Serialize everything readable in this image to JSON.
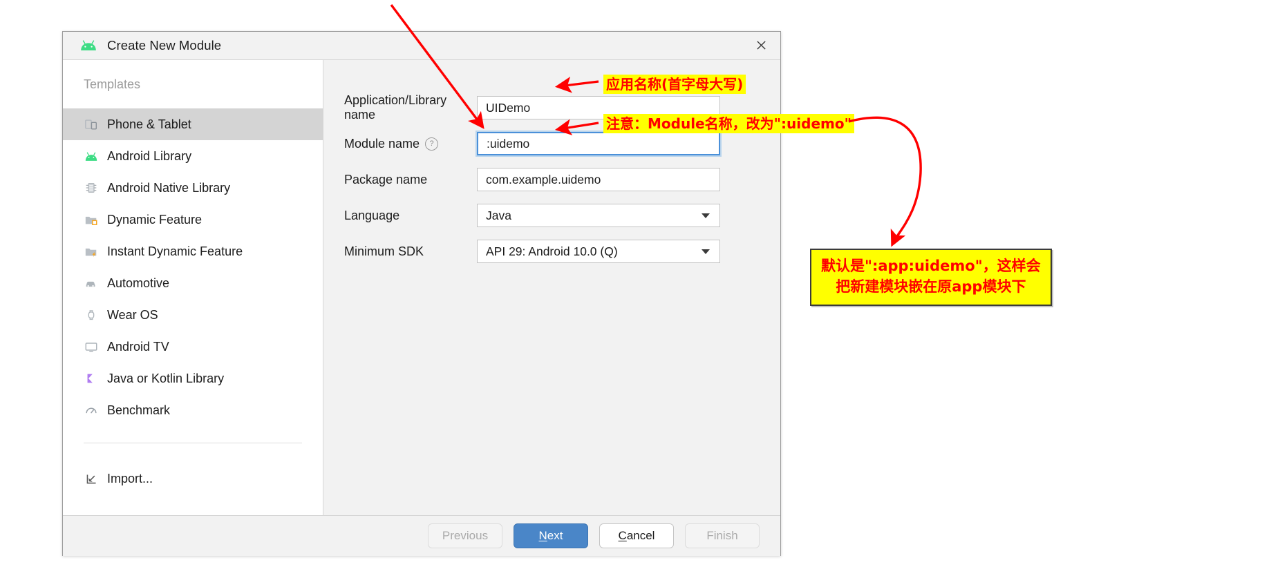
{
  "dialog": {
    "title": "Create New Module",
    "logo_icon": "android-logo-icon",
    "close_icon": "close-icon"
  },
  "sidebar": {
    "header": "Templates",
    "items": [
      {
        "label": "Phone & Tablet",
        "icon": "phone-tablet-icon",
        "selected": true
      },
      {
        "label": "Android Library",
        "icon": "android-library-icon",
        "selected": false
      },
      {
        "label": "Android Native Library",
        "icon": "android-native-library-icon",
        "selected": false
      },
      {
        "label": "Dynamic Feature",
        "icon": "dynamic-feature-icon",
        "selected": false
      },
      {
        "label": "Instant Dynamic Feature",
        "icon": "instant-dynamic-feature-icon",
        "selected": false
      },
      {
        "label": "Automotive",
        "icon": "automotive-icon",
        "selected": false
      },
      {
        "label": "Wear OS",
        "icon": "wear-os-icon",
        "selected": false
      },
      {
        "label": "Android TV",
        "icon": "android-tv-icon",
        "selected": false
      },
      {
        "label": "Java or Kotlin Library",
        "icon": "java-kotlin-library-icon",
        "selected": false
      },
      {
        "label": "Benchmark",
        "icon": "benchmark-icon",
        "selected": false
      }
    ],
    "import_label": "Import...",
    "import_icon": "import-icon"
  },
  "form": {
    "app_name": {
      "label": "Application/Library name",
      "value": "UIDemo"
    },
    "module_name": {
      "label": "Module name",
      "help_icon": "help-icon",
      "value": ":uidemo",
      "focused": true
    },
    "package_name": {
      "label": "Package name",
      "value": "com.example.uidemo"
    },
    "language": {
      "label": "Language",
      "value": "Java",
      "dropdown_icon": "chevron-down-icon"
    },
    "min_sdk": {
      "label": "Minimum SDK",
      "value": "API 29: Android 10.0 (Q)",
      "dropdown_icon": "chevron-down-icon"
    }
  },
  "footer": {
    "previous": "Previous",
    "next": "Next",
    "next_mnemonic": "N",
    "cancel": "Cancel",
    "cancel_mnemonic": "C",
    "finish": "Finish"
  },
  "annotations": {
    "app_name_note": "应用名称(首字母大写)",
    "module_name_note": "注意：Module名称，改为\":uidemo\"",
    "warning_line1": "默认是\":app:uidemo\"，这样会",
    "warning_line2": "把新建模块嵌在原app模块下"
  },
  "colors": {
    "highlight": "#ffff00",
    "annotation_text": "#ff0000",
    "primary_button": "#4a86c8",
    "selection": "#d4d4d4",
    "focus_border": "#4a90d9",
    "android_green": "#3ddc84"
  }
}
